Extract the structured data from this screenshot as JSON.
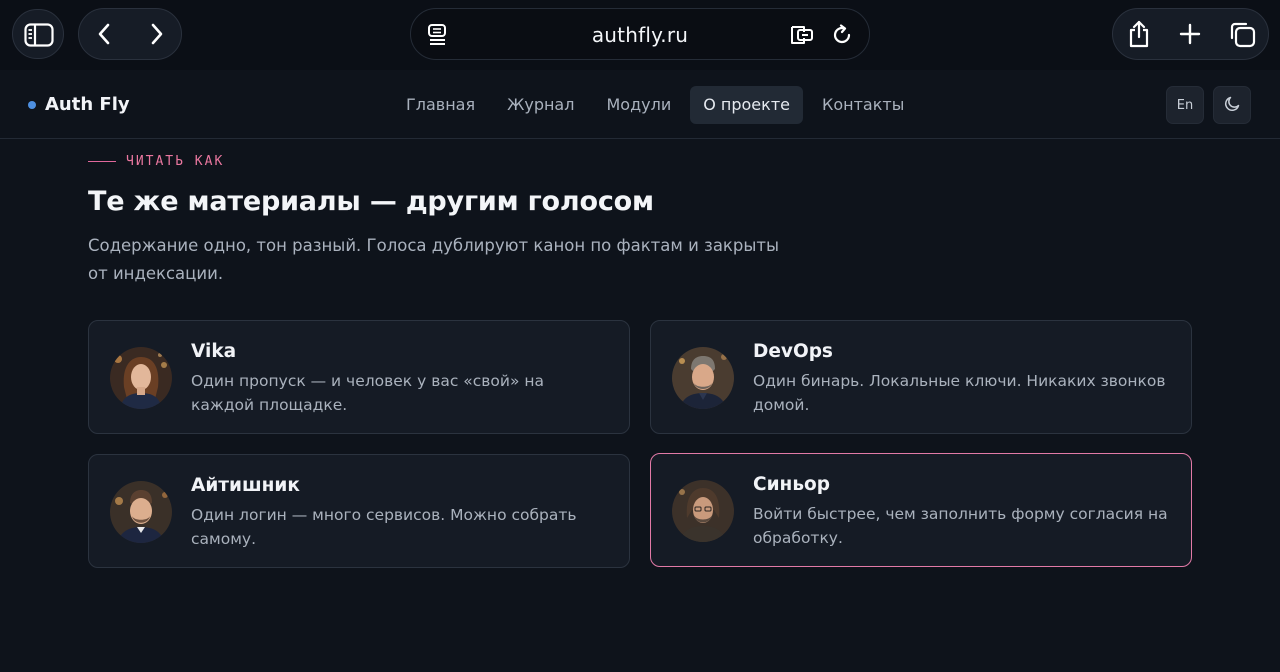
{
  "browser": {
    "url": "authfly.ru",
    "icons": {
      "sidebar": "sidebar-toggle-icon",
      "back": "chevron-left-icon",
      "forward": "chevron-right-icon",
      "reader": "reader-mode-icon",
      "tab_share": "translate-page-icon",
      "reload": "reload-icon",
      "share": "share-icon",
      "new_tab": "plus-icon",
      "tabs": "tabs-overview-icon"
    }
  },
  "header": {
    "brand": "Auth Fly",
    "nav": [
      {
        "label": "Главная"
      },
      {
        "label": "Журнал"
      },
      {
        "label": "Модули"
      },
      {
        "label": "О проекте",
        "active": true
      },
      {
        "label": "Контакты"
      }
    ],
    "lang_button": "En",
    "accent_color": "#4d8fe0"
  },
  "section": {
    "eyebrow": "ЧИТАТЬ КАК",
    "title": "Те же материалы — другим голосом",
    "lead": "Содержание одно, тон разный. Голоса дублируют канон по фактам и закрыты от индексации.",
    "accent_color": "#e27aa7"
  },
  "voices": [
    {
      "name": "Vika",
      "text": "Один пропуск — и человек у вас «свой» на каждой площадке."
    },
    {
      "name": "DevOps",
      "text": "Один бинарь. Локальные ключи. Никаких звонков домой."
    },
    {
      "name": "Айтишник",
      "text": "Один логин — много сервисов. Можно собрать самому."
    },
    {
      "name": "Синьор",
      "text": "Войти быстрее, чем заполнить форму согласия на обработку.",
      "selected": true
    }
  ]
}
